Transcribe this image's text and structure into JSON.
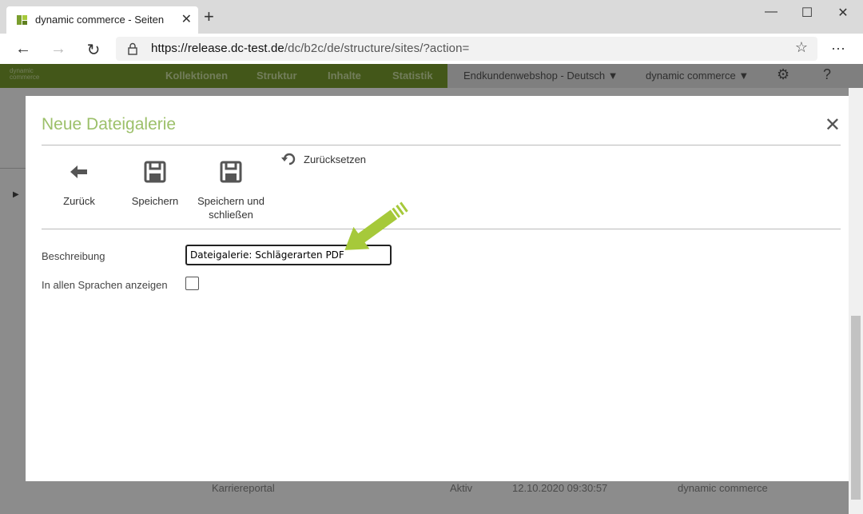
{
  "browser": {
    "tab_title": "dynamic commerce - Seiten",
    "url_host": "https://release.dc-test.de",
    "url_path": "/dc/b2c/de/structure/sites/?action="
  },
  "app": {
    "logo_line1": "dynamic",
    "logo_line2": "commerce",
    "nav": [
      "Kollektionen",
      "Struktur",
      "Inhalte",
      "Statistik"
    ],
    "shop_select": "Endkundenwebshop - Deutsch",
    "company_select": "dynamic commerce",
    "help": "?"
  },
  "background_row": {
    "name": "Karriereportal",
    "status": "Aktiv",
    "date": "12.10.2020 09:30:57",
    "author": "dynamic commerce"
  },
  "modal": {
    "title": "Neue Dateigalerie",
    "toolbar": {
      "back": "Zurück",
      "save": "Speichern",
      "save_close": "Speichern und schließen",
      "reset": "Zurücksetzen"
    },
    "form": {
      "description_label": "Beschreibung",
      "description_value": "Dateigalerie: Schlägerarten PDF",
      "all_languages_label": "In allen Sprachen anzeigen",
      "all_languages_checked": false
    }
  },
  "colors": {
    "brand_green": "#7a9e2e",
    "title_green": "#9cc06a",
    "arrow_green": "#a6c93a"
  }
}
